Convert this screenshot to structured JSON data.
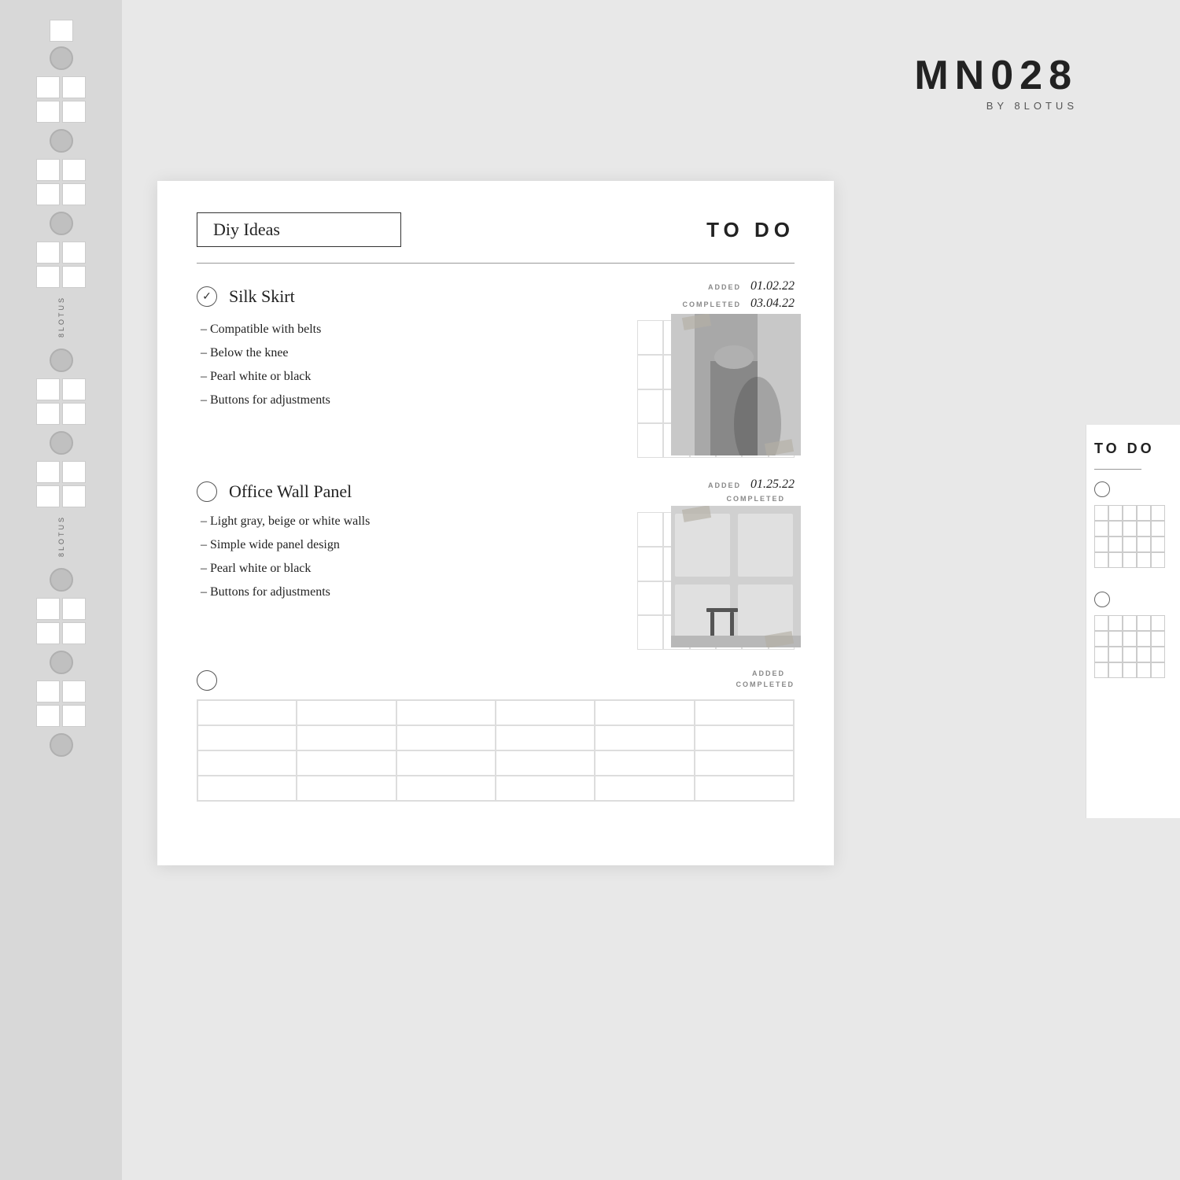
{
  "brand": {
    "code": "MN028",
    "byline": "BY 8LOTUS"
  },
  "sidebar": {
    "label1": "8LOTUS",
    "label2": "8LOTUS"
  },
  "main_page": {
    "title": "Diy Ideas",
    "todo_header": "TO DO"
  },
  "tasks": [
    {
      "id": "task-1",
      "title": "Silk Skirt",
      "completed": true,
      "check_symbol": "✓",
      "added_label": "ADDED",
      "added_date": "01.02.22",
      "completed_label": "COMPLETED",
      "completed_date": "03.04.22",
      "bullets": [
        "– Compatible with belts",
        "– Below the knee",
        "– Pearl white or black",
        "– Buttons for adjustments"
      ]
    },
    {
      "id": "task-2",
      "title": "Office Wall Panel",
      "completed": false,
      "check_symbol": "",
      "added_label": "ADDED",
      "added_date": "01.25.22",
      "completed_label": "COMPLETED",
      "completed_date": "",
      "bullets": [
        "– Light gray, beige or white walls",
        "– Simple wide panel design",
        "– Pearl white or black",
        "– Buttons for adjustments"
      ]
    },
    {
      "id": "task-3",
      "title": "",
      "completed": false,
      "check_symbol": "",
      "added_label": "ADDED",
      "added_date": "",
      "completed_label": "COMPLETED",
      "completed_date": "",
      "bullets": []
    }
  ],
  "right_page": {
    "todo_header": "TO DO"
  }
}
